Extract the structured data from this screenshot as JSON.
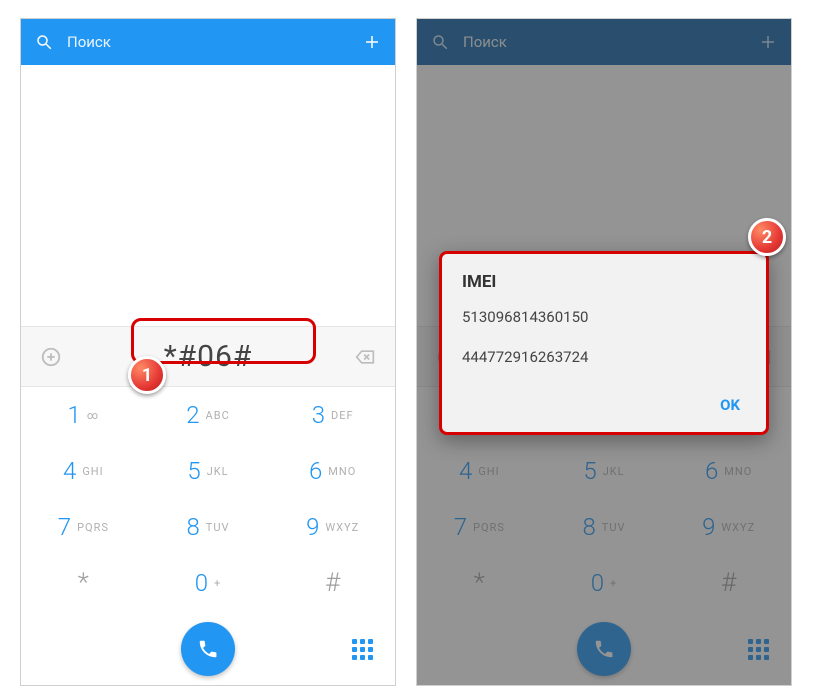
{
  "search": {
    "placeholder": "Поиск"
  },
  "entry": {
    "code": "*#06#"
  },
  "keypad": {
    "keys": [
      {
        "d": "1",
        "s": "∞"
      },
      {
        "d": "2",
        "s": "ABC"
      },
      {
        "d": "3",
        "s": "DEF"
      },
      {
        "d": "4",
        "s": "GHI"
      },
      {
        "d": "5",
        "s": "JKL"
      },
      {
        "d": "6",
        "s": "MNO"
      },
      {
        "d": "7",
        "s": "PQRS"
      },
      {
        "d": "8",
        "s": "TUV"
      },
      {
        "d": "9",
        "s": "WXYZ"
      },
      {
        "d": "*",
        "s": ""
      },
      {
        "d": "0",
        "s": "+"
      },
      {
        "d": "#",
        "s": ""
      }
    ]
  },
  "dialog": {
    "title": "IMEI",
    "imei1": "513096814360150",
    "imei2": "444772916263724",
    "ok": "OK"
  },
  "callouts": {
    "one": "1",
    "two": "2"
  }
}
